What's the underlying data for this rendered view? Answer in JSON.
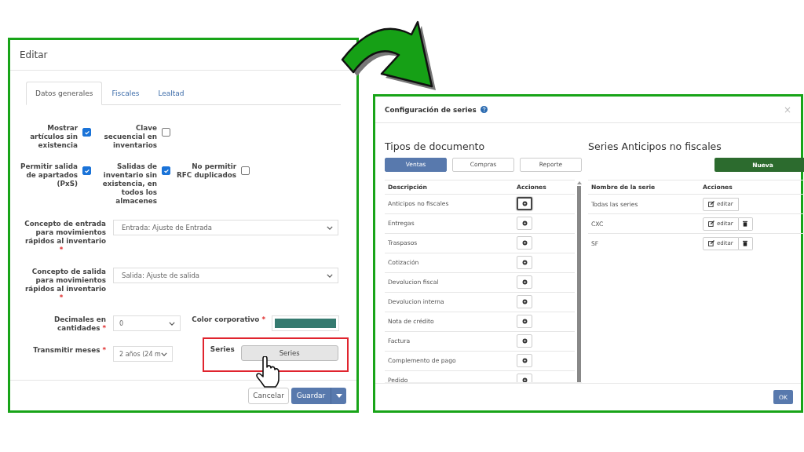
{
  "left_dialog": {
    "title": "Editar",
    "tabs": [
      {
        "label": "Datos generales",
        "selected": true
      },
      {
        "label": "Fiscales",
        "selected": false
      },
      {
        "label": "Lealtad",
        "selected": false
      }
    ],
    "checkbox_rows": [
      [
        {
          "label": "Mostrar artículos sin existencia",
          "checked": true
        },
        {
          "label": "Clave secuencial en inventarios",
          "checked": false
        }
      ],
      [
        {
          "label": "Permitir salida de apartados (PxS)",
          "checked": true
        },
        {
          "label": "Salidas de inventario sin existencia, en todos los almacenes",
          "checked": true
        },
        {
          "label": "No permitir RFC duplicados",
          "checked": false
        }
      ]
    ],
    "field_rows": [
      [
        {
          "kind": "wide-select",
          "label": "Concepto de entrada para movimientos rápidos al inventario",
          "required_mark": "*",
          "value": "Entrada: Ajuste de Entrada"
        }
      ],
      [
        {
          "kind": "wide-select",
          "label": "Concepto de salida para movimientos rápidos al inventario",
          "required_mark": "*",
          "value": "Salida: Ajuste de salida"
        }
      ],
      [
        {
          "kind": "select",
          "label": "Decimales en cantidades",
          "required_mark": "*",
          "value": "0"
        },
        {
          "kind": "color",
          "label": "Color corporativo",
          "required_mark": "*",
          "color": "#357a6f"
        }
      ],
      [
        {
          "kind": "select",
          "label": "Transmitir meses",
          "required_mark": "*",
          "value": "2 años (24 m"
        },
        {
          "kind": "button",
          "label": "Series",
          "button": "Series",
          "highlighted": true
        }
      ]
    ],
    "footer_buttons": [
      {
        "label": "Cancelar",
        "kind": "plain"
      },
      {
        "label": "Guardar",
        "kind": "split"
      }
    ]
  },
  "right_dialog": {
    "title": "Configuración de series",
    "close": "×",
    "document_types": {
      "heading": "Tipos de documento",
      "filters": [
        {
          "label": "Ventas",
          "selected": true
        },
        {
          "label": "Compras",
          "selected": false
        },
        {
          "label": "Reporte",
          "selected": false
        }
      ],
      "columns": [
        "Descripción",
        "Acciones"
      ],
      "rows": [
        {
          "description": "Anticipos no fiscales",
          "selected": true
        },
        {
          "description": "Entregas",
          "selected": false
        },
        {
          "description": "Traspasos",
          "selected": false
        },
        {
          "description": "Cotización",
          "selected": false
        },
        {
          "description": "Devolucion fiscal",
          "selected": false
        },
        {
          "description": "Devolucion interna",
          "selected": false
        },
        {
          "description": "Nota de crédito",
          "selected": false
        },
        {
          "description": "Factura",
          "selected": false
        },
        {
          "description": "Complemento de pago",
          "selected": false
        },
        {
          "description": "Pedido",
          "selected": false
        }
      ]
    },
    "series": {
      "heading": "Series Anticipos no fiscales",
      "new_button": "Nueva",
      "columns": [
        "Nombre de la serie",
        "Acciones"
      ],
      "rows": [
        {
          "name": "Todas las series",
          "edit": "editar",
          "deletable": false
        },
        {
          "name": "CXC",
          "edit": "editar",
          "deletable": true
        },
        {
          "name": "SF",
          "edit": "editar",
          "deletable": true
        }
      ]
    },
    "ok_button": "OK"
  }
}
